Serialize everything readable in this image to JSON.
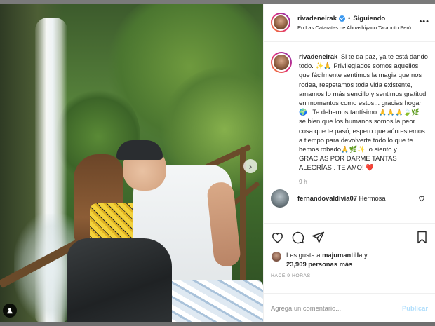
{
  "post": {
    "author": {
      "username": "rivadeneirak",
      "verified": true,
      "follow_state": "Siguiendo",
      "separator": "•",
      "location": "En Las Cataratas de Ahuashiyaco Tarapoto Perú"
    },
    "caption": {
      "username": "rivadeneirak",
      "text": "Si te da paz, ya te está dando todo. ✨🙏 Privilegiados somos aquellos que fácilmente sentimos la magia que nos rodea, respetamos toda vida existente, amamos lo más sencillo y sentimos gratitud en momentos como estos... gracias hogar 🌍 . Te debemos tantísimo 🙏🙏🙏🍃🌿 se bien que los humanos somos la peor cosa que te pasó, espero que aún estemos a tiempo para devolverte todo lo que te hemos robado🙏🌿✨ lo siento y GRACIAS POR DARME TANTAS ALEGRÍAS . TE AMO! ❤️",
      "time_ago": "9 h"
    },
    "comments": [
      {
        "username": "fernandovaldivia07",
        "text": "Hermosa"
      }
    ],
    "likes": {
      "prefix": "Les gusta a",
      "user": "majumantilla",
      "connector": "y",
      "count": "23,909 personas más"
    },
    "date": "HACE 9 HORAS",
    "add_comment_placeholder": "Agrega un comentario...",
    "publish_label": "Publicar"
  },
  "icons": {
    "more": "more-options-icon",
    "like": "heart-icon",
    "comment": "comment-icon",
    "share": "share-icon",
    "save": "bookmark-icon",
    "next": "chevron-right-icon",
    "tag": "user-tag-icon"
  },
  "colors": {
    "verified": "#3897f0",
    "publish_disabled": "#b2dffc",
    "muted_text": "#8e8e8e",
    "text": "#262626"
  }
}
